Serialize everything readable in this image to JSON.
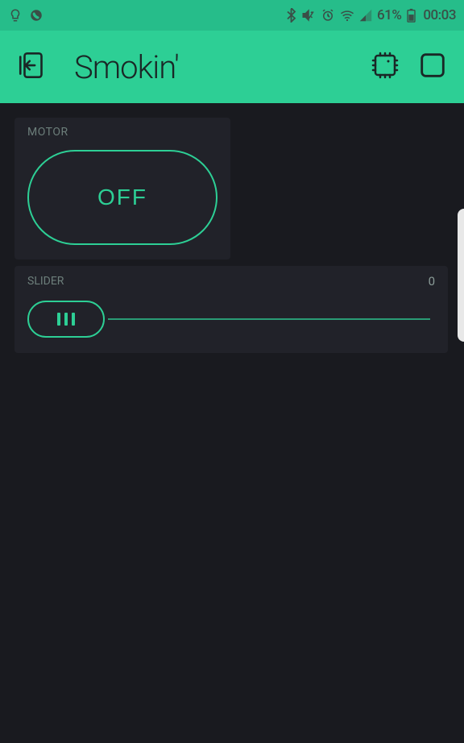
{
  "status": {
    "battery_pct": "61%",
    "time": "00:03"
  },
  "app": {
    "title": "Smokin'"
  },
  "motor": {
    "label": "MOTOR",
    "state": "OFF"
  },
  "slider": {
    "label": "SLIDER",
    "value": "0"
  }
}
